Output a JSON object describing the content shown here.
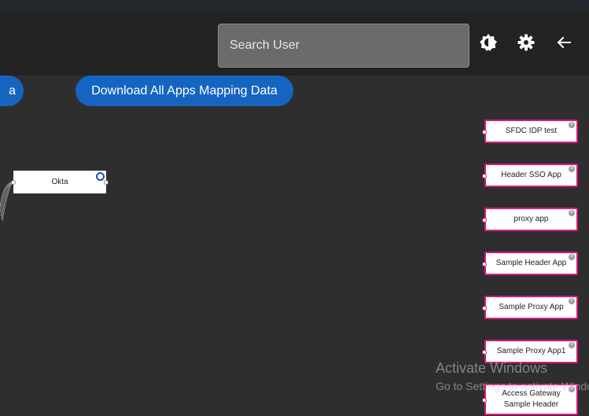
{
  "header": {
    "search_placeholder": "Search User",
    "icons": [
      "brightness-icon",
      "gear-icon",
      "back-arrow-icon"
    ]
  },
  "actions": {
    "partial_button_label": "a",
    "download_label": "Download All Apps Mapping Data"
  },
  "graph": {
    "idp_node": "Okta",
    "apps": [
      {
        "label": "SFDC IDP test"
      },
      {
        "label": "Header SSO App"
      },
      {
        "label": "proxy app"
      },
      {
        "label": "Sample Header App"
      },
      {
        "label": "Sample Proxy App"
      },
      {
        "label": "Sample Proxy App1"
      },
      {
        "label": "Access Gateway Sample Header"
      }
    ],
    "colors": {
      "app_border": "#d81b7a",
      "idp_badge": "#1f4bb8",
      "button": "#1565c0"
    }
  },
  "watermark": {
    "title": "Activate Windows",
    "subtitle": "Go to Settings to activate Windows."
  }
}
